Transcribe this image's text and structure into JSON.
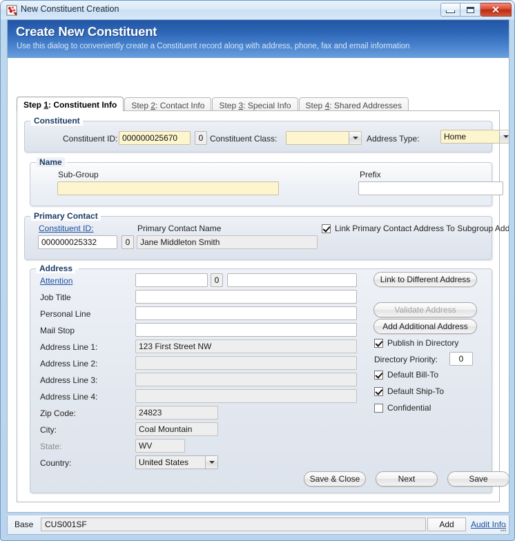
{
  "window": {
    "title": "New Constituent Creation",
    "icon": "app-icon",
    "buttons": {
      "minimize": "minimize-icon",
      "maximize": "restore-icon",
      "close": "✕"
    }
  },
  "banner": {
    "title": "Create New Constituent",
    "subtitle": "Use this dialog to conveniently create a Constituent record along with address, phone, fax and email information"
  },
  "tabs": [
    {
      "prefix": "Step ",
      "mnemonic": "1",
      "suffix": ": Constituent Info",
      "active": true
    },
    {
      "prefix": "Step ",
      "mnemonic": "2",
      "suffix": ": Contact Info",
      "active": false
    },
    {
      "prefix": "Step ",
      "mnemonic": "3",
      "suffix": ": Special Info",
      "active": false
    },
    {
      "prefix": "Step ",
      "mnemonic": "4",
      "suffix": ": Shared Addresses",
      "active": false
    }
  ],
  "constituent_group": {
    "title": "Constituent",
    "id_label": "Constituent ID:",
    "id_value": "000000025670",
    "id_suffix": "0",
    "class_label": "Constituent Class:",
    "class_value": "",
    "address_type_label": "Address Type:",
    "address_type_value": "Home"
  },
  "name_group": {
    "title": "Name",
    "subgroup_label": "Sub-Group",
    "subgroup_value": "",
    "prefix_label": "Prefix",
    "prefix_value": ""
  },
  "primary_contact_group": {
    "title": "Primary Contact",
    "id_link": "Constituent ID:",
    "id_value": "000000025332",
    "id_suffix": "0",
    "name_label": "Primary Contact Name",
    "name_value": "Jane Middleton Smith",
    "link_checkbox_label": "Link Primary Contact Address To Subgroup Address",
    "link_checkbox_checked": true
  },
  "address_group": {
    "title": "Address",
    "attention_link": "Attention",
    "attention_value": "",
    "attention_suffix": "0",
    "attention_value2": "",
    "fields": [
      {
        "label": "Job Title",
        "value": "",
        "readonly": false,
        "dim": false
      },
      {
        "label": "Personal Line",
        "value": "",
        "readonly": false,
        "dim": false
      },
      {
        "label": "Mail Stop",
        "value": "",
        "readonly": false,
        "dim": false
      },
      {
        "label": "Address Line 1:",
        "value": "123 First Street NW",
        "readonly": true,
        "dim": false
      },
      {
        "label": "Address Line 2:",
        "value": "",
        "readonly": true,
        "dim": false
      },
      {
        "label": "Address Line 3:",
        "value": "",
        "readonly": true,
        "dim": false
      },
      {
        "label": "Address Line 4:",
        "value": "",
        "readonly": true,
        "dim": false
      }
    ],
    "zip_label": "Zip Code:",
    "zip_value": "24823",
    "city_label": "City:",
    "city_value": "Coal Mountain",
    "state_label": "State:",
    "state_value": "WV",
    "country_label": "Country:",
    "country_value": "United States",
    "buttons": {
      "link_different": "Link to Different Address",
      "validate": "Validate Address",
      "add_additional": "Add Additional Address"
    },
    "options": {
      "publish_label": "Publish in Directory",
      "publish_checked": true,
      "priority_label": "Directory Priority:",
      "priority_value": "0",
      "bill_to_label": "Default Bill-To",
      "bill_to_checked": true,
      "ship_to_label": "Default Ship-To",
      "ship_to_checked": true,
      "confidential_label": "Confidential",
      "confidential_checked": false
    }
  },
  "actions": {
    "save_close": "Save & Close",
    "next": "Next",
    "save": "Save"
  },
  "statusbar": {
    "base_label": "Base",
    "base_value": "CUS001SF",
    "add_label": "Add",
    "audit_link": "Audit Info"
  }
}
